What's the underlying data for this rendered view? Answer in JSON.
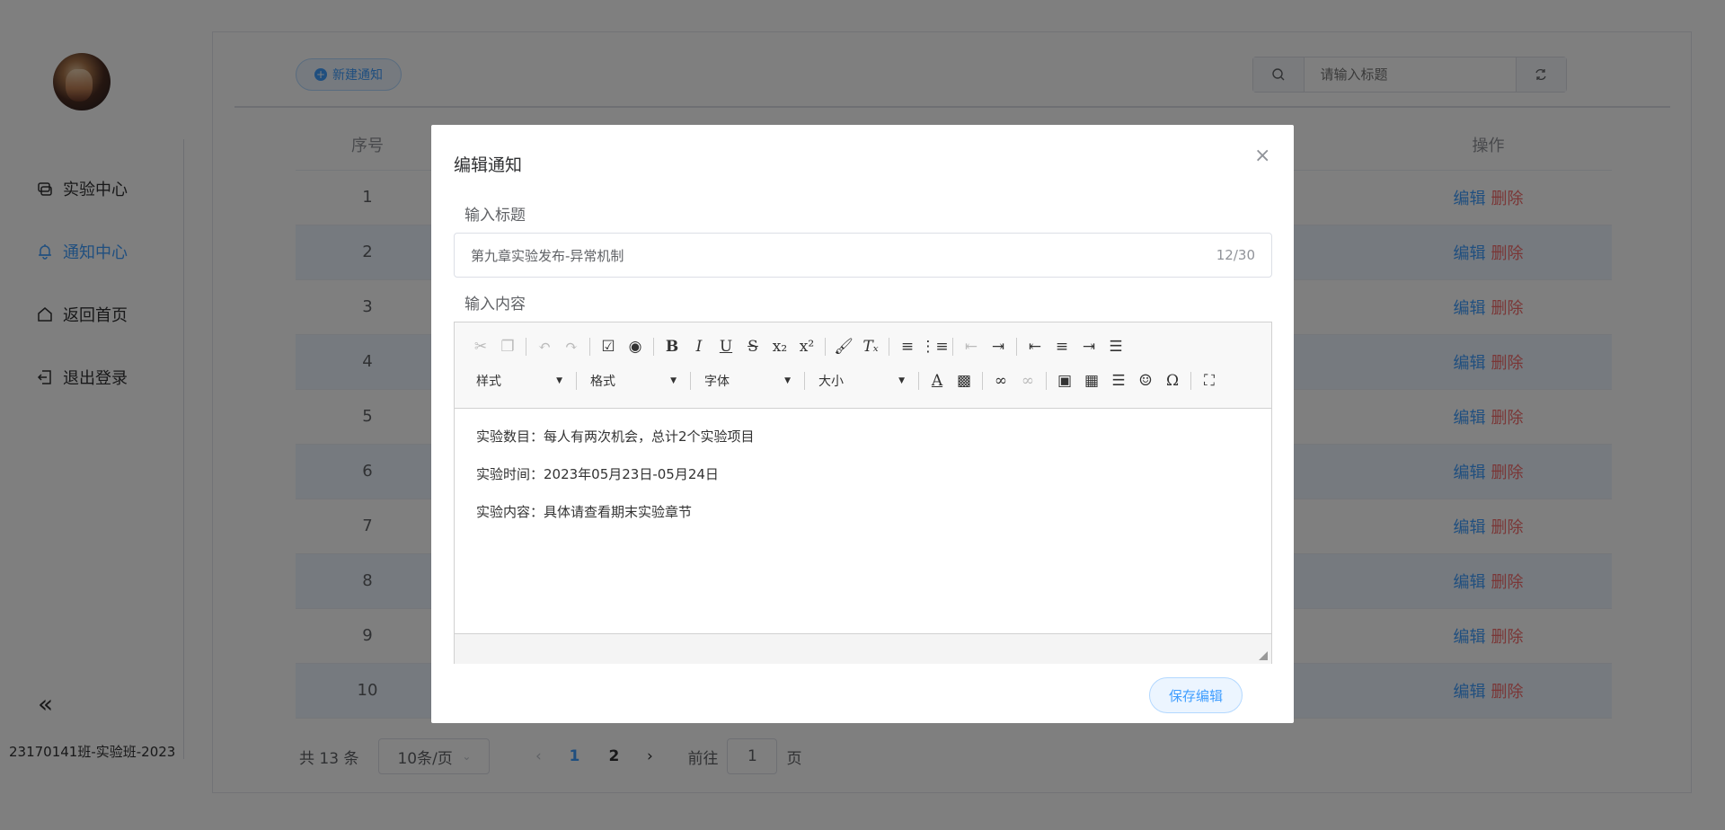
{
  "sidebar": {
    "items": [
      {
        "label": "实验中心",
        "icon": "experiment-icon",
        "active": false
      },
      {
        "label": "通知中心",
        "icon": "bell-icon",
        "active": true
      },
      {
        "label": "返回首页",
        "icon": "home-icon",
        "active": false
      },
      {
        "label": "退出登录",
        "icon": "logout-icon",
        "active": false
      }
    ],
    "collapse_glyph": "«",
    "class_label": "23170141班-实验班-2023"
  },
  "toolbar": {
    "new_label": "新建通知",
    "search_placeholder": "请输入标题"
  },
  "table": {
    "headers": {
      "index": "序号",
      "ops": "操作"
    },
    "rows": [
      {
        "index": "1"
      },
      {
        "index": "2"
      },
      {
        "index": "3"
      },
      {
        "index": "4"
      },
      {
        "index": "5"
      },
      {
        "index": "6"
      },
      {
        "index": "7"
      },
      {
        "index": "8"
      },
      {
        "index": "9"
      },
      {
        "index": "10"
      }
    ],
    "edit_label": "编辑",
    "delete_label": "删除"
  },
  "pagination": {
    "total": "共 13 条",
    "page_size": "10条/页",
    "pages": [
      "1",
      "2"
    ],
    "current_page": "1",
    "goto_prefix": "前往",
    "goto_value": "1",
    "goto_suffix": "页"
  },
  "dialog": {
    "title": "编辑通知",
    "title_label": "输入标题",
    "title_value": "第九章实验发布-异常机制",
    "title_count": "12/30",
    "content_label": "输入内容",
    "dropdowns": [
      "样式",
      "格式",
      "字体",
      "大小"
    ],
    "content_lines": [
      "实验数目：每人有两次机会，总计2个实验项目",
      "实验时间：2023年05月23日-05月24日",
      "实验内容：具体请查看期末实验章节"
    ],
    "save_label": "保存编辑",
    "close_glyph": "×"
  },
  "colors": {
    "accent": "#409eff",
    "danger": "#f56c6c",
    "overlay": "rgba(0,0,0,0.5)"
  }
}
